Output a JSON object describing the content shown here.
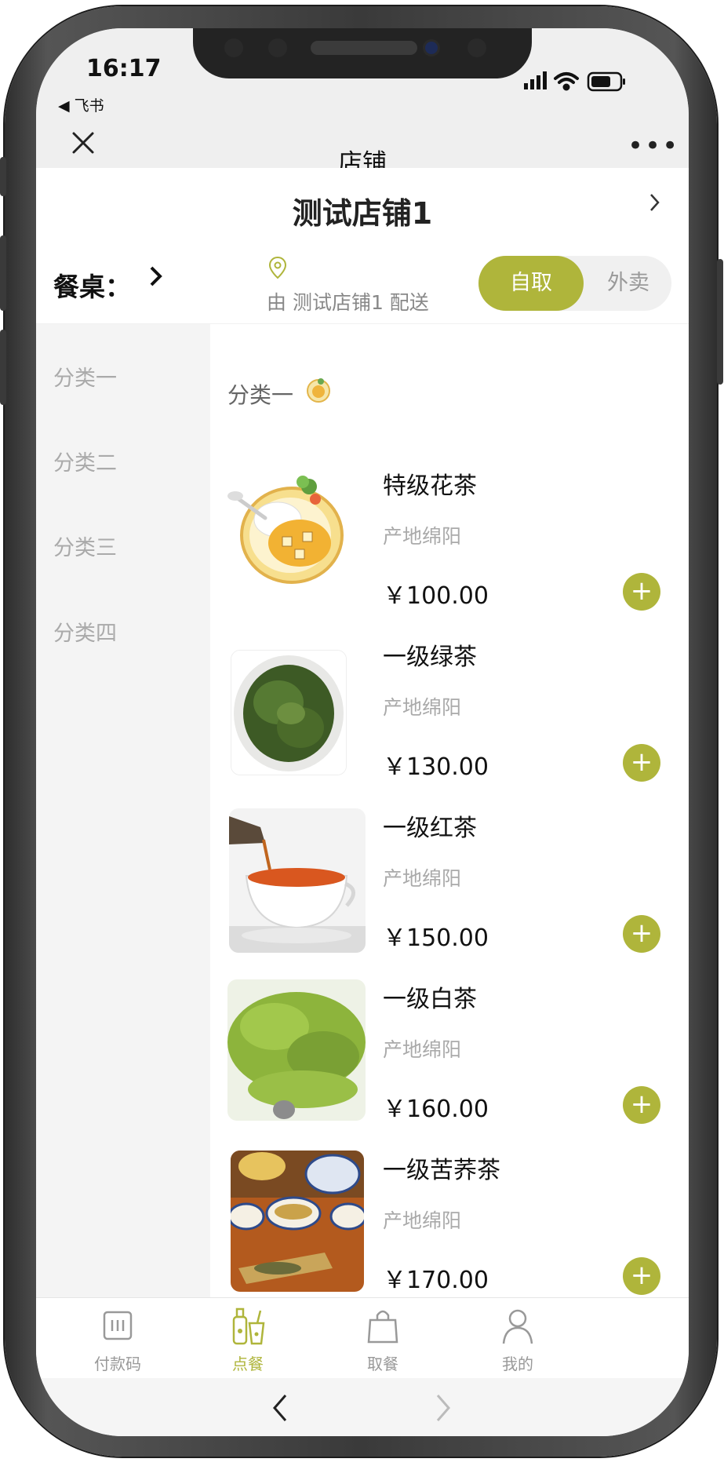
{
  "status": {
    "time": "16:17",
    "back_app": "◀ 飞书"
  },
  "navbar": {
    "title": "店铺",
    "more": "•••"
  },
  "shop": {
    "name": "测试店铺1"
  },
  "table": {
    "label": "餐桌：",
    "chevron": "›"
  },
  "delivery": {
    "text": "由 测试店铺1 配送"
  },
  "mode": {
    "active": "自取",
    "inactive": "外卖"
  },
  "categories": [
    "分类一",
    "分类二",
    "分类三",
    "分类四"
  ],
  "section": {
    "title": "分类一"
  },
  "items": [
    {
      "name": "特级花茶",
      "origin": "产地绵阳",
      "price": "￥100.00"
    },
    {
      "name": "一级绿茶",
      "origin": "产地绵阳",
      "price": "￥130.00"
    },
    {
      "name": "一级红茶",
      "origin": "产地绵阳",
      "price": "￥150.00"
    },
    {
      "name": "一级白茶",
      "origin": "产地绵阳",
      "price": "￥160.00"
    },
    {
      "name": "一级苦荞茶",
      "origin": "产地绵阳",
      "price": "￥170.00"
    }
  ],
  "tabs": [
    {
      "label": "付款码",
      "icon": "payment-code-icon"
    },
    {
      "label": "点餐",
      "icon": "order-food-icon"
    },
    {
      "label": "取餐",
      "icon": "pickup-bag-icon"
    },
    {
      "label": "我的",
      "icon": "profile-icon"
    }
  ],
  "colors": {
    "accent": "#afb53b",
    "muted": "#999999",
    "sidebar_bg": "#f4f4f4"
  }
}
